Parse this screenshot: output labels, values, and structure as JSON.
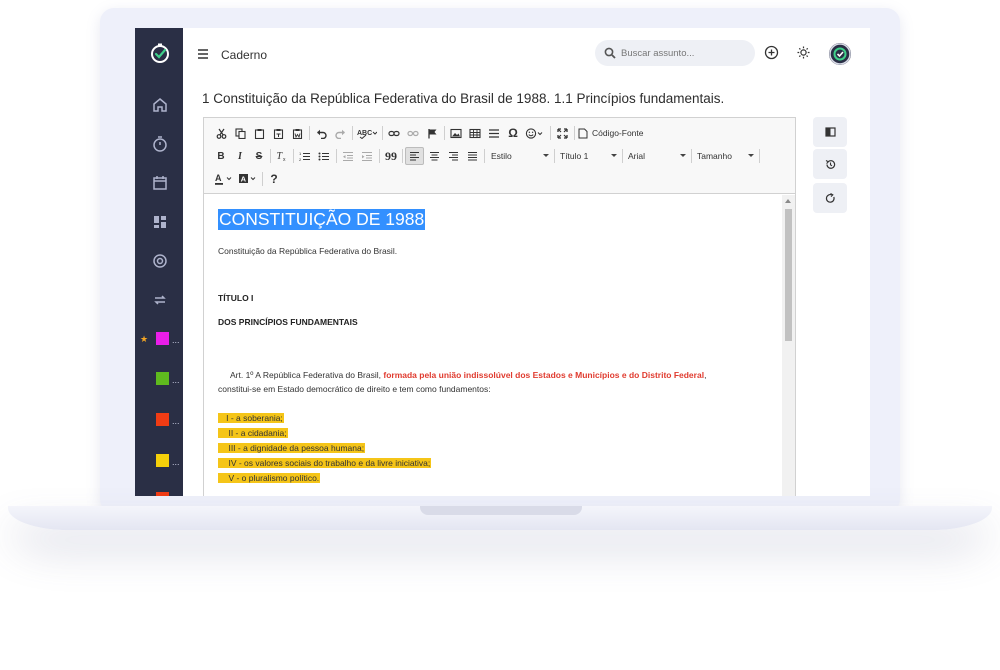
{
  "app": {
    "title": "Caderno",
    "search_placeholder": "Buscar assunto..."
  },
  "page": {
    "title": "1 Constituição da República Federativa do Brasil de 1988. 1.1 Princípios fundamentais."
  },
  "toolbar": {
    "source_label": "Código-Fonte",
    "style_label": "Estilo",
    "format_label": "Título 1",
    "font_label": "Arial",
    "size_label": "Tamanho",
    "help_label": "?",
    "bold_label": "B",
    "italic_label": "I",
    "strike_label": "S",
    "quote_label": "99"
  },
  "document": {
    "heading": "CONSTITUIÇÃO DE 1988",
    "subtitle": "Constituição da República Federativa do Brasil.",
    "titulo": "TÍTULO I",
    "principios": "DOS PRINCÍPIOS FUNDAMENTAIS",
    "art_prefix": "Art. 1º A República Federativa do Brasil, ",
    "art_red": "formada pela união indissolúvel dos Estados e Municípios e do Distrito Federal",
    "art_suffix": ",",
    "art_line2": "constitui-se em Estado democrático de direito e tem como fundamentos:",
    "items": [
      "I - a soberania;",
      "II - a cidadania;",
      "III - a dignidade da pessoa humana;",
      "IV - os valores sociais do trabalho e da livre iniciativa;",
      "V - o pluralismo político."
    ]
  },
  "sidebar": {
    "folders": [
      {
        "color": "#e91ee9",
        "starred": true,
        "label": "..."
      },
      {
        "color": "#5fba1e",
        "label": "..."
      },
      {
        "color": "#f03c14",
        "label": "..."
      },
      {
        "color": "#f5d00a",
        "label": "..."
      }
    ]
  },
  "colors": {
    "sidebar_bg": "#2a2f45",
    "accent_green": "#3fd08a",
    "highlight_yellow": "#f5c518",
    "text_red": "#e03b2f",
    "selection_blue": "#3390ff"
  }
}
